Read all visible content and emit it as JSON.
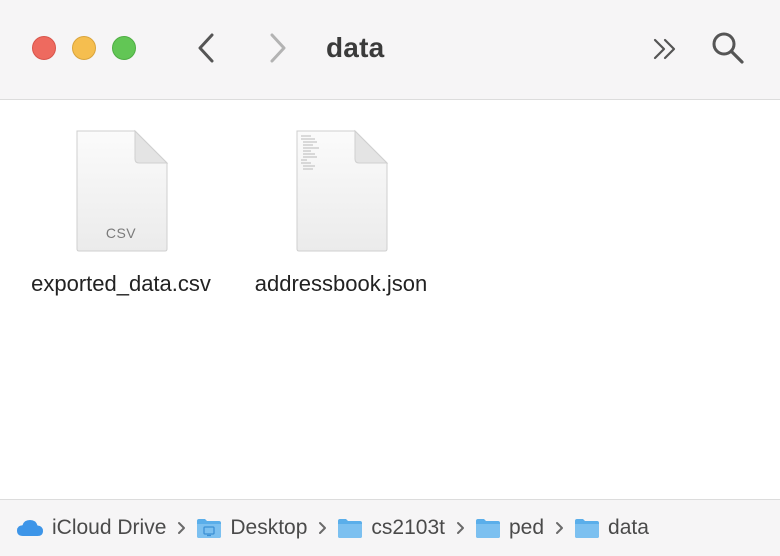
{
  "window": {
    "title": "data"
  },
  "toolbar": {
    "back_icon": "chevron-left-icon",
    "forward_icon": "chevron-right-icon",
    "more_icon": "double-chevron-right-icon",
    "search_icon": "magnifier-icon"
  },
  "traffic_lights": {
    "close_color": "#ee6a5f",
    "minimize_color": "#f5be4f",
    "maximize_color": "#62c655"
  },
  "files": [
    {
      "name": "exported_data.csv",
      "icon": "csv-document-icon",
      "badge": "CSV"
    },
    {
      "name": "addressbook.json",
      "icon": "text-document-icon",
      "badge": ""
    }
  ],
  "path": [
    {
      "label": "iCloud Drive",
      "icon": "cloud-icon"
    },
    {
      "label": "Desktop",
      "icon": "desktop-folder-icon"
    },
    {
      "label": "cs2103t",
      "icon": "folder-icon"
    },
    {
      "label": "ped",
      "icon": "folder-icon"
    },
    {
      "label": "data",
      "icon": "folder-icon"
    }
  ],
  "colors": {
    "folder": "#5aaeea",
    "cloud": "#3d95e8"
  }
}
